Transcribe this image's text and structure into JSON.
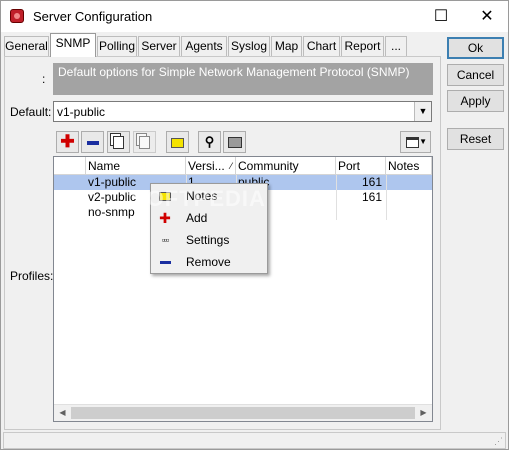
{
  "window": {
    "title": "Server Configuration"
  },
  "tabs": [
    {
      "label": "General"
    },
    {
      "label": "SNMP"
    },
    {
      "label": "Polling"
    },
    {
      "label": "Server"
    },
    {
      "label": "Agents"
    },
    {
      "label": "Syslog"
    },
    {
      "label": "Map"
    },
    {
      "label": "Chart"
    },
    {
      "label": "Report"
    },
    {
      "label": "..."
    }
  ],
  "description": {
    "colon": ":",
    "text": "Default options for Simple Network Management Protocol (SNMP)"
  },
  "default_field": {
    "label": "Default:",
    "value": "v1-public"
  },
  "profiles": {
    "label": "Profiles:"
  },
  "table": {
    "columns": [
      "Name",
      "Versi...",
      "Community",
      "Port",
      "Notes"
    ],
    "rows": [
      {
        "name": "v1-public",
        "version": "1",
        "community": "public",
        "port": "161",
        "notes": ""
      },
      {
        "name": "v2-public",
        "version": "",
        "community": "",
        "port": "161",
        "notes": ""
      },
      {
        "name": "no-snmp",
        "version": "",
        "community": "",
        "port": "",
        "notes": ""
      }
    ]
  },
  "context_menu": {
    "items": [
      {
        "label": "Notes",
        "icon": "folder-icon"
      },
      {
        "label": "Add",
        "icon": "plus-icon"
      },
      {
        "label": "Settings",
        "icon": "dots-icon"
      },
      {
        "label": "Remove",
        "icon": "minus-icon"
      }
    ]
  },
  "buttons": {
    "ok": "Ok",
    "cancel": "Cancel",
    "apply": "Apply",
    "reset": "Reset"
  },
  "watermark": "SOFTPEDIA",
  "colors": {
    "selection": "#aec6ee",
    "description_bg": "#a3a3a3",
    "accent": "#3c7fb1",
    "red": "#d00000",
    "blue": "#1a2ea0"
  }
}
